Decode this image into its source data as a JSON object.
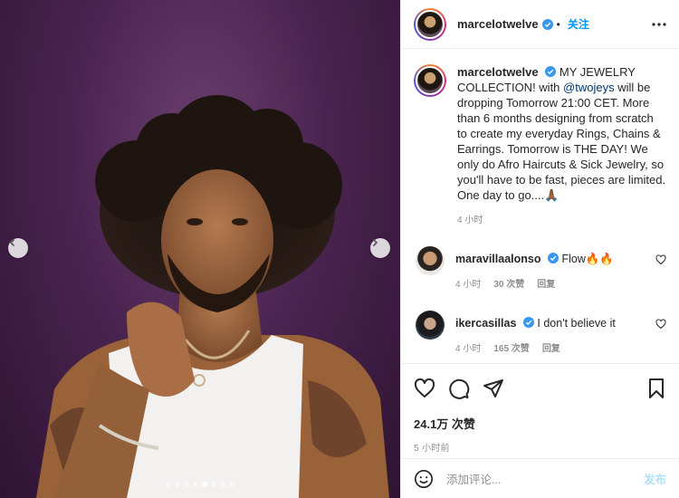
{
  "post": {
    "username": "marcelotwelve",
    "follow_label": "关注",
    "follow_separator": "•",
    "caption_lead": "MY JEWELRY COLLECTION! with ",
    "caption_mention": "@twojeys",
    "caption_rest": " will be dropping Tomorrow 21:00 CET. More than 6 months designing from scratch to create my everyday Rings, Chains & Earrings. Tomorrow is THE DAY! We only do Afro Haircuts & Sick Jewelry, so you'll have to be fast, pieces are limited. One day to go....🙏🏾",
    "caption_time": "4 小时"
  },
  "comments": [
    {
      "username": "maravillaalonso",
      "text": "Flow🔥🔥",
      "time": "4 小时",
      "likes": "30 次赞",
      "reply": "回复"
    },
    {
      "username": "ikercasillas",
      "text": "I don't believe it",
      "time": "4 小时",
      "likes": "165 次赞",
      "reply": "回复"
    }
  ],
  "stats": {
    "likes": "24.1万 次赞",
    "posted": "5 小时前"
  },
  "composer": {
    "placeholder": "添加评论...",
    "post_label": "发布"
  },
  "carousel": {
    "total": 8,
    "active_index": 4
  },
  "icons": {
    "verified": "verified-badge-icon",
    "more": "more-options-icon",
    "like": "heart-icon",
    "comment": "comment-bubble-icon",
    "share": "paper-plane-icon",
    "save": "bookmark-icon",
    "emoji": "smile-icon",
    "prev": "chevron-left-icon",
    "next": "chevron-right-icon"
  },
  "colors": {
    "accent": "#0095f6",
    "verified": "#3897f0",
    "photo_bg": "#4a2450"
  }
}
